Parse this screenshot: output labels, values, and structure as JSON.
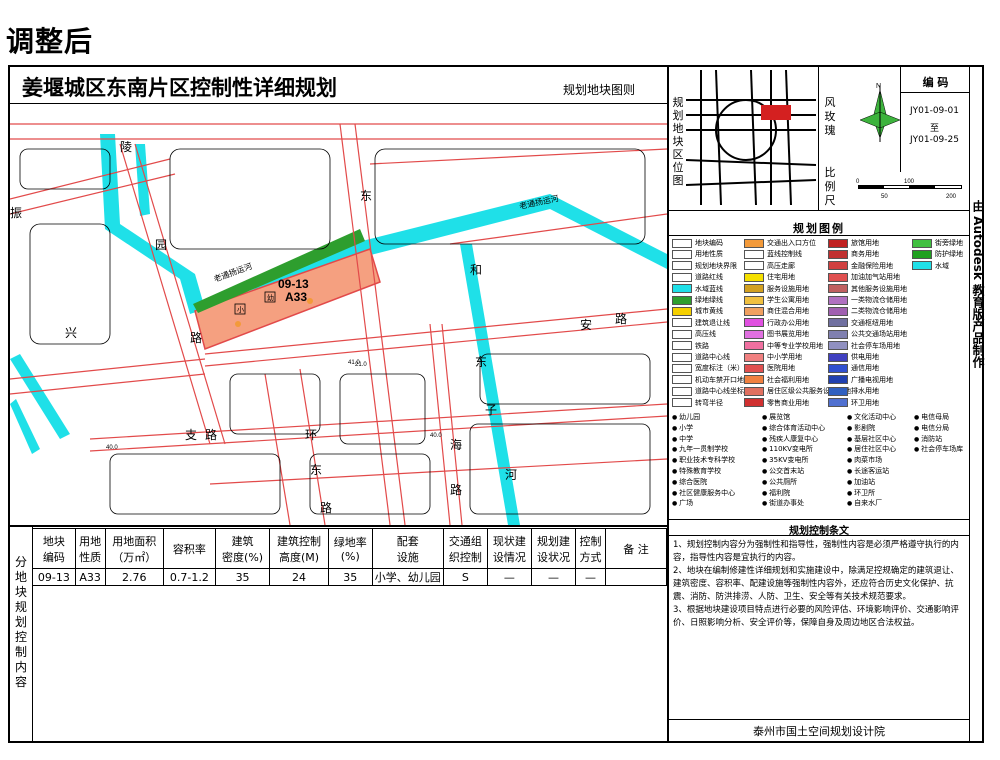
{
  "header": {
    "title": "调整后"
  },
  "map": {
    "title": "姜堰城区东南片区控制性详细规划",
    "subtitle": "规划地块图则",
    "parcel_code": "09-13",
    "parcel_use": "A33",
    "labels": {
      "school": "小",
      "kinder": "幼",
      "canal1": "老通扬运河",
      "canal2": "老通扬运河"
    },
    "roads": [
      "陵",
      "园",
      "东",
      "振",
      "兴",
      "路",
      "和",
      "东",
      "安",
      "路",
      "子",
      "海",
      "河",
      "路",
      "支",
      "路",
      "环",
      "东",
      "路"
    ],
    "dims": [
      "21.0",
      "40.0",
      "41.0",
      "40.0"
    ]
  },
  "side_panel": {
    "location_label": "规划地块区位图",
    "windrose_label": "风玫瑰",
    "scale_label": "比例尺",
    "scale_ticks": [
      "0",
      "100",
      "50",
      "200"
    ],
    "code_header": "编 码",
    "code_from": "JY01-09-01",
    "code_to_word": "至",
    "code_to": "JY01-09-25",
    "north": "N",
    "legend_title": "规划图例",
    "rules_title": "规划控制条文",
    "rules": [
      "1、规划控制内容分为强制性和指导性，强制性内容是必须严格遵守执行的内容，指导性内容是宜执行的内容。",
      "2、地块在编制修建性详细规划和实施建设中，除满足控规确定的建筑退让、建筑密度、容积率、配建设施等强制性内容外，还应符合历史文化保护、抗震、消防、防洪排涝、人防、卫生、安全等有关技术规范要求。",
      "3、根据地块建设项目特点进行必要的风险评估、环境影响评价、交通影响评价、日照影响分析、安全评价等，保障自身及周边地区合法权益。"
    ],
    "institute": "泰州市国土空间规划设计院",
    "vertical_credit": "由 Autodesk 教育版产品制作"
  },
  "legend": {
    "col1": [
      "地块编码",
      "用地性质",
      "规划地块界限",
      "道路红线",
      "水域蓝线",
      "绿地绿线",
      "城市黄线",
      "建筑退让线",
      "高压线",
      "铁路",
      "道路中心线",
      "宽度标注（米）",
      "机动车禁开口地段",
      "道路中心线坐标",
      "转弯半径"
    ],
    "col2": [
      "交通出入口方位",
      "蓝线控制线",
      "高压走廊",
      "住宅用地",
      "服务设施用地",
      "学生公寓用地",
      "商住混合用地",
      "行政办公用地",
      "图书展览用地",
      "中等专业学校用地",
      "中小学用地",
      "医院用地",
      "社会福利用地",
      "居住区级公共服务设施用地",
      "零售商业用地"
    ],
    "col3": [
      "旅馆用地",
      "商务用地",
      "金融保险用地",
      "加油加气站用地",
      "其他服务设施用地",
      "一类物流仓储用地",
      "二类物流仓储用地",
      "交通枢纽用地",
      "公共交通场站用地",
      "社会停车场用地",
      "供电用地",
      "通信用地",
      "广播电视用地",
      "排水用地",
      "环卫用地"
    ],
    "col4": [
      "街旁绿地",
      "防护绿地",
      "水域"
    ],
    "fac1": [
      "幼儿园",
      "小学",
      "中学",
      "九年一贯制学校",
      "职业技术专科学校",
      "特殊教育学校",
      "综合医院",
      "社区健康服务中心",
      "广场"
    ],
    "fac2": [
      "展览馆",
      "综合体育活动中心",
      "残疾人康复中心",
      "110KV变电所",
      "35KV变电所",
      "公交首末站",
      "公共厕所",
      "福利院",
      "街道办事处"
    ],
    "fac3": [
      "文化活动中心",
      "影剧院",
      "基层社区中心",
      "居住社区中心",
      "肉菜市场",
      "长途客运站",
      "加油站",
      "环卫所",
      "自来水厂"
    ],
    "fac4": [
      "电信母局",
      "电信分局",
      "消防站",
      "社会停车场库"
    ]
  },
  "table": {
    "side_label": "分地块规划控制内容",
    "headers": [
      [
        "地块",
        "编码"
      ],
      [
        "用地",
        "性质"
      ],
      [
        "用地面积",
        "（万㎡）"
      ],
      [
        "容积率",
        ""
      ],
      [
        "建筑",
        "密度(%)"
      ],
      [
        "建筑控制",
        "高度(M)"
      ],
      [
        "绿地率",
        "(%)"
      ],
      [
        "配套",
        "设施"
      ],
      [
        "交通组",
        "织控制"
      ],
      [
        "现状建",
        "设情况"
      ],
      [
        "规划建",
        "设状况"
      ],
      [
        "控制",
        "方式"
      ],
      [
        "备 注",
        ""
      ]
    ],
    "row": [
      "09-13",
      "A33",
      "2.76",
      "0.7-1.2",
      "35",
      "24",
      "35",
      "小学、幼儿园",
      "S",
      "—",
      "—",
      "—",
      ""
    ]
  },
  "colors": {
    "road": "#e24a4a",
    "water": "#1fe0e8",
    "parcel": "#f5a080",
    "green": "#2e9e2e",
    "black": "#000000"
  }
}
